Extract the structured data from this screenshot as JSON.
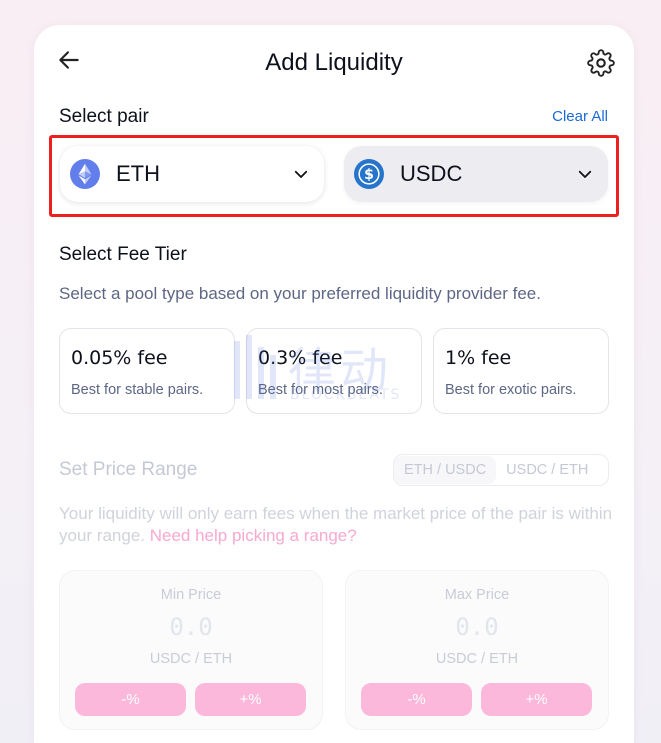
{
  "header": {
    "title": "Add Liquidity"
  },
  "pair": {
    "label": "Select pair",
    "clear_all": "Clear All",
    "token_a": "ETH",
    "token_b": "USDC"
  },
  "fee": {
    "label": "Select Fee Tier",
    "description": "Select a pool type based on your preferred liquidity provider fee.",
    "tiers": [
      {
        "amount": "0.05% fee",
        "desc": "Best for stable pairs."
      },
      {
        "amount": "0.3% fee",
        "desc": "Best for most pairs."
      },
      {
        "amount": "1% fee",
        "desc": "Best for exotic pairs."
      }
    ]
  },
  "watermark": {
    "main": "律动",
    "sub": "BLOCKBEATS"
  },
  "range": {
    "title": "Set Price Range",
    "toggle": [
      "ETH / USDC",
      "USDC / ETH"
    ],
    "desc": "Your liquidity will only earn fees when the market price of the pair is within your range.",
    "help_link": "Need help picking a range?",
    "min": {
      "label": "Min Price",
      "value": "0.0",
      "unit": "USDC / ETH",
      "dec": "-%",
      "inc": "+%"
    },
    "max": {
      "label": "Max Price",
      "value": "0.0",
      "unit": "USDC / ETH",
      "dec": "-%",
      "inc": "+%"
    }
  },
  "colors": {
    "accent_link": "#1b6bd6",
    "highlight": "#ee1f1f",
    "pink": "#fbb8da",
    "eth": "#627eea",
    "usdc": "#2775ca"
  }
}
